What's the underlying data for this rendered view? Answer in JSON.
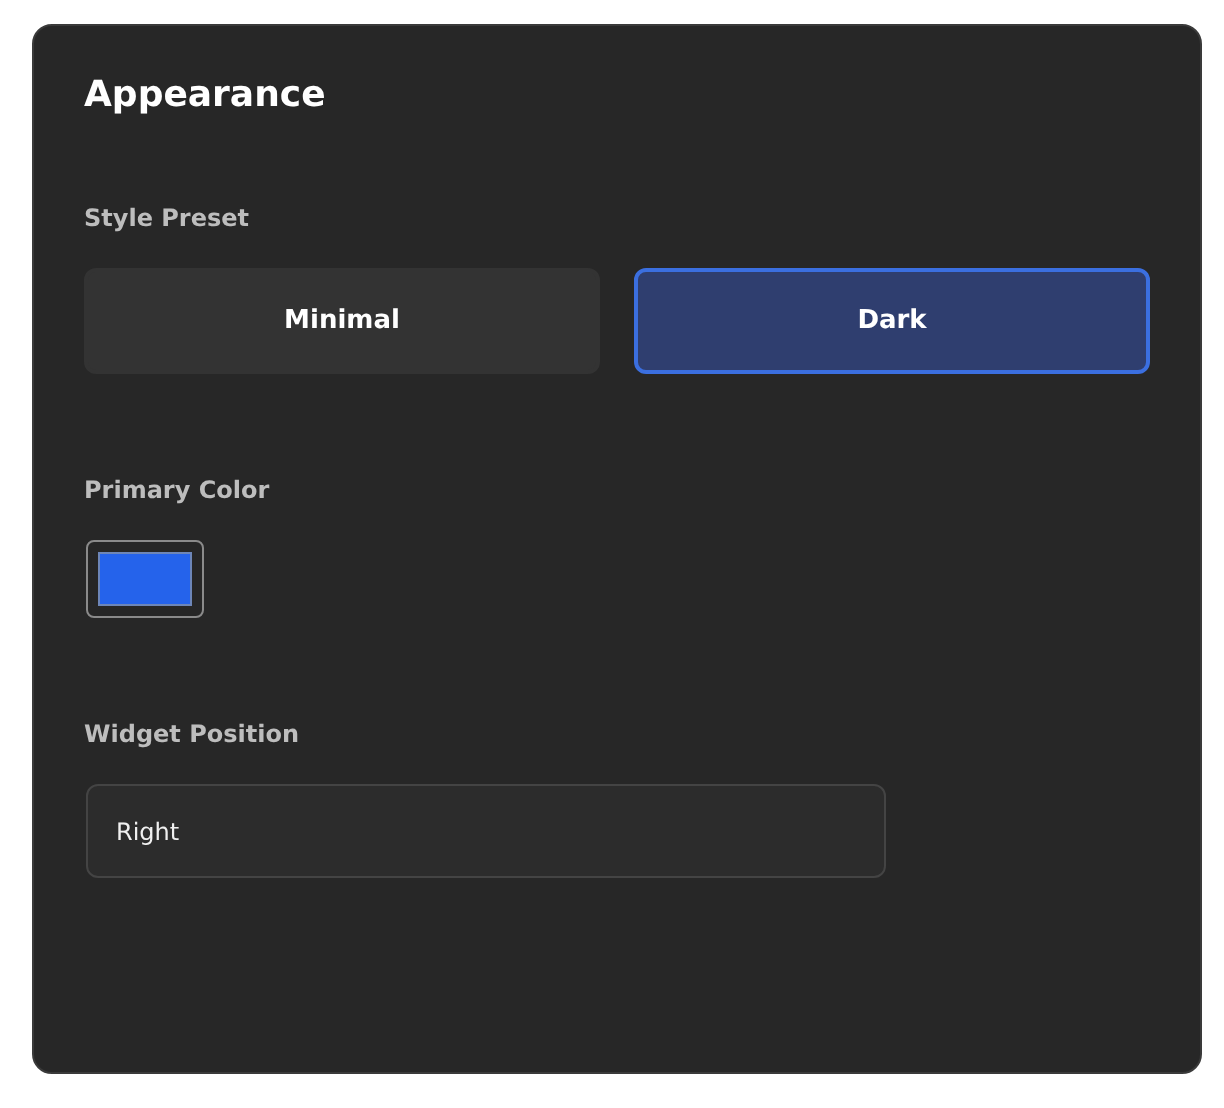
{
  "title": "Appearance",
  "style_preset": {
    "label": "Style Preset",
    "options": [
      {
        "label": "Minimal",
        "selected": false
      },
      {
        "label": "Dark",
        "selected": true
      }
    ]
  },
  "primary_color": {
    "label": "Primary Color",
    "color": "#2563eb"
  },
  "widget_position": {
    "label": "Widget Position",
    "value": "Right"
  }
}
